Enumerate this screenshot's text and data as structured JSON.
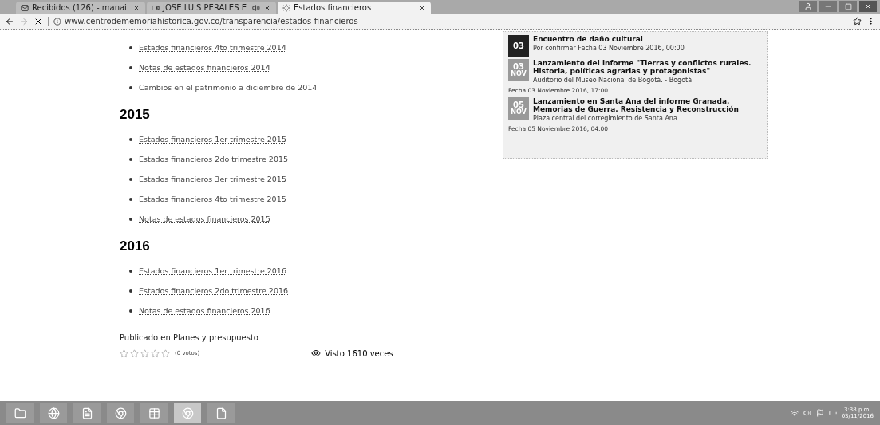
{
  "browser": {
    "tabs": [
      {
        "title": "Recibidos (126) - manai",
        "kind": "mail",
        "audio": false,
        "selected": false
      },
      {
        "title": "JOSE LUIS PERALES E",
        "kind": "video",
        "audio": true,
        "selected": false
      },
      {
        "title": "Estados financieros",
        "kind": "loading",
        "audio": false,
        "selected": true
      }
    ],
    "url": "www.centrodememoriahistorica.gov.co/transparencia/estados-financieros"
  },
  "sections": [
    {
      "items": [
        {
          "text": "Estados financieros 4to trimestre 2014",
          "link": true
        },
        {
          "text": "Notas de estados financieros 2014",
          "link": true
        },
        {
          "text": "Cambios en el patrimonio a diciembre de 2014",
          "link": false
        }
      ]
    },
    {
      "heading": "2015",
      "items": [
        {
          "text": "Estados financieros 1er trimestre 2015",
          "link": true
        },
        {
          "text": "Estados financieros 2do trimestre 2015",
          "link": false
        },
        {
          "text": "Estados financieros 3er trimestre 2015",
          "link": true
        },
        {
          "text": "Estados financieros 4to trimestre 2015",
          "link": true
        },
        {
          "text": "Notas de estados financieros 2015",
          "link": true
        }
      ]
    },
    {
      "heading": "2016",
      "items": [
        {
          "text": "Estados financieros 1er trimestre 2016",
          "link": true
        },
        {
          "text": "Estados financieros 2do trimestre 2016",
          "link": true
        },
        {
          "text": "Notas de estados financieros 2016",
          "link": true
        }
      ]
    }
  ],
  "published": "Publicado en Planes y presupuesto",
  "rating": {
    "stars": 0,
    "votes": "(0 votos)"
  },
  "views": "Visto 1610 veces",
  "events": [
    {
      "day": "03",
      "title": "Encuentro de daño cultural",
      "place": "Por confirmar Fecha 03 Noviembre 2016, 00:00",
      "highlighted": true
    },
    {
      "day": "03",
      "month": "NOV",
      "title": "Lanzamiento del informe \"Tierras y conflictos rurales. Historia, políticas agrarias y protagonistas\"",
      "place": "Auditorio del Museo Nacional de Bogotá. - Bogotá",
      "date": "Fecha 03 Noviembre 2016, 17:00",
      "highlighted": false
    },
    {
      "day": "05",
      "month": "NOV",
      "title": "Lanzamiento en Santa Ana del informe Granada. Memorias de Guerra. Resistencia y Reconstrucción",
      "place": "Plaza central del corregimiento de Santa Ana",
      "date": "Fecha 05 Noviembre 2016, 04:00",
      "highlighted": false
    }
  ],
  "taskbar": {
    "apps": [
      {
        "kind": "files",
        "selected": false
      },
      {
        "kind": "ie",
        "selected": false
      },
      {
        "kind": "word",
        "selected": false
      },
      {
        "kind": "chrome",
        "selected": false
      },
      {
        "kind": "excel",
        "selected": false
      },
      {
        "kind": "chrome",
        "selected": true
      },
      {
        "kind": "pdf",
        "selected": false
      }
    ],
    "time": "3:38 p.m.",
    "date": "03/11/2016"
  }
}
